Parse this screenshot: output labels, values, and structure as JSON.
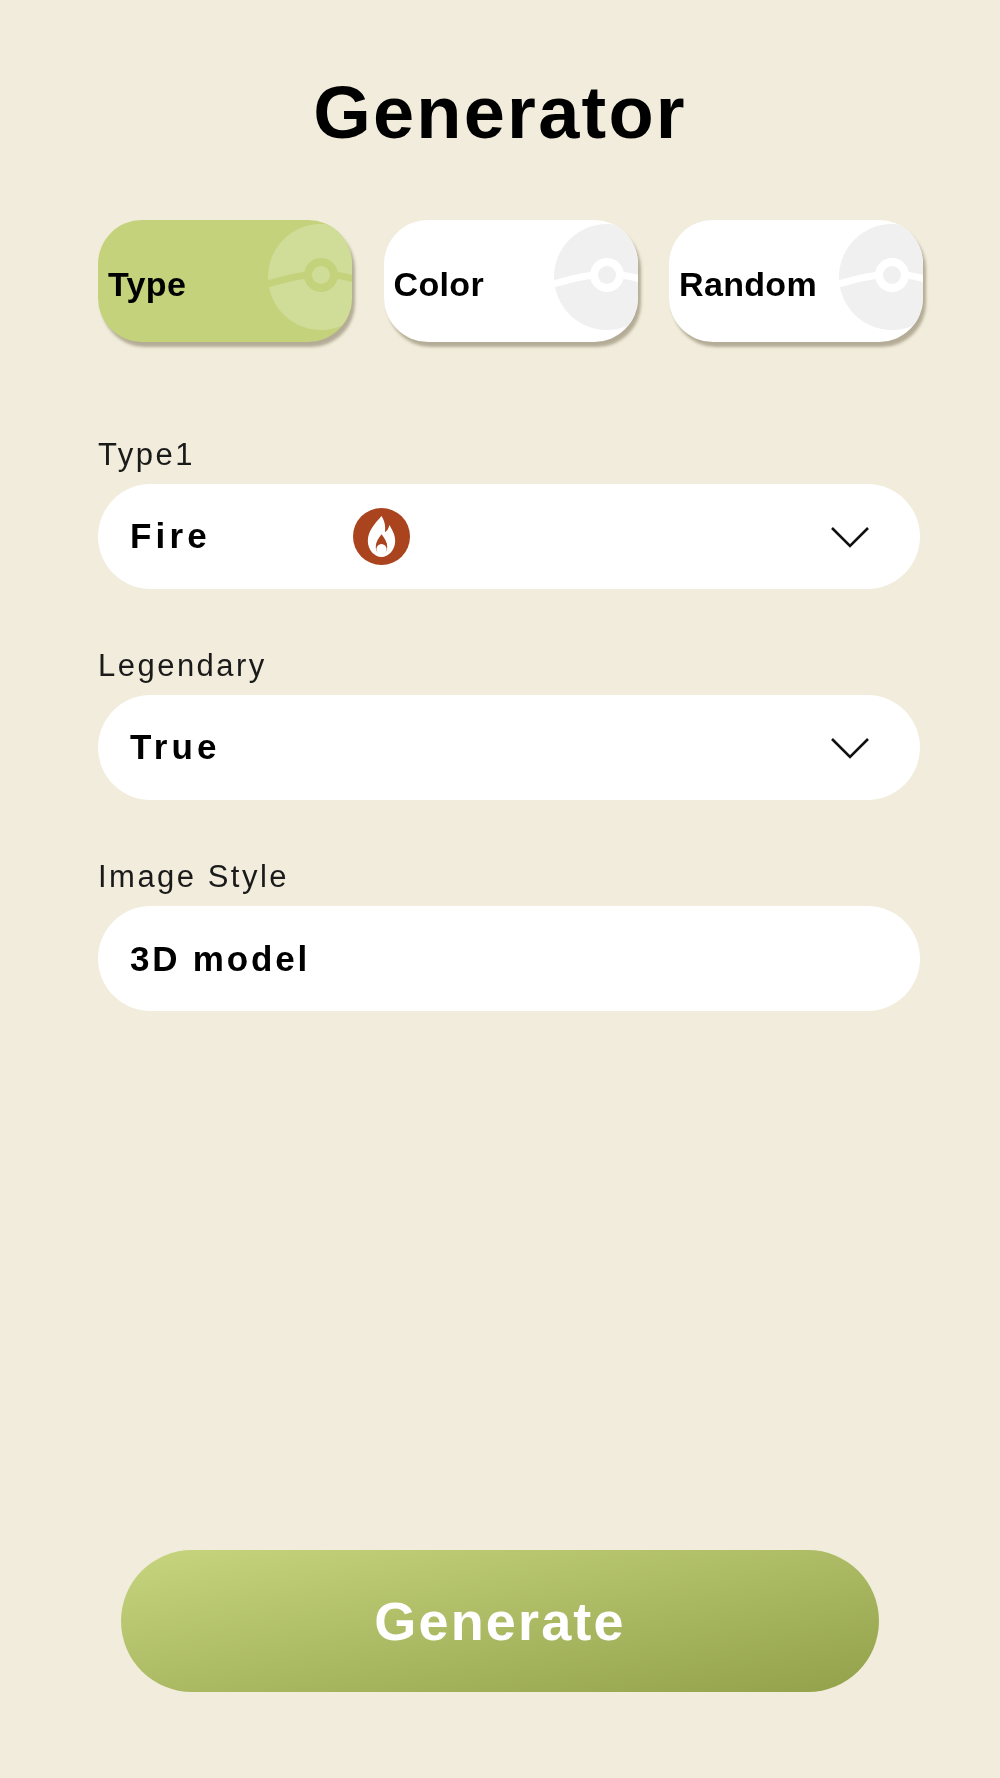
{
  "title": "Generator",
  "tabs": [
    {
      "label": "Type",
      "selected": true
    },
    {
      "label": "Color",
      "selected": false
    },
    {
      "label": "Random",
      "selected": false
    }
  ],
  "fields": [
    {
      "label": "Type1",
      "kind": "select",
      "value": "Fire",
      "icon": true
    },
    {
      "label": "Legendary",
      "kind": "select",
      "value": "True"
    },
    {
      "label": "Image Style",
      "kind": "text",
      "value": "3D model"
    }
  ],
  "generate_button": {
    "label": "Generate"
  }
}
